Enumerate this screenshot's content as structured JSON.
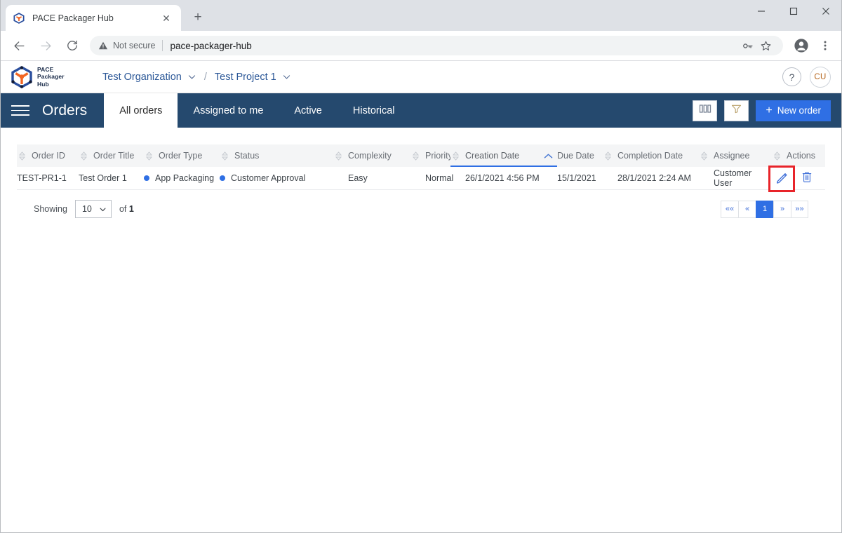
{
  "browser": {
    "tab": {
      "title": "PACE Packager Hub",
      "favicon": "cube-icon",
      "close": "✕"
    },
    "new_tab": "+",
    "window_controls": {
      "minimize": "—",
      "maximize": "□",
      "close": "✕"
    },
    "nav": {
      "back": "←",
      "forward": "→",
      "reload": "↻"
    },
    "omnibox": {
      "security_label": "Not secure",
      "url": "pace-packager-hub",
      "key_icon": "key-icon",
      "star_icon": "star-icon"
    },
    "toolbar_right": {
      "profile_icon": "profile-avatar-icon",
      "menu_icon": "three-dot-menu-icon"
    }
  },
  "app_header": {
    "logo": {
      "line1": "PACE",
      "line2": "Packager",
      "line3": "Hub"
    },
    "breadcrumb": {
      "organization": "Test Organization",
      "separator": "/",
      "project": "Test Project 1"
    },
    "help_label": "?",
    "avatar_initials": "CU"
  },
  "navbar": {
    "menu_icon": "hamburger-menu-icon",
    "title": "Orders",
    "tabs": [
      {
        "label": "All orders",
        "active": true
      },
      {
        "label": "Assigned to me",
        "active": false
      },
      {
        "label": "Active",
        "active": false
      },
      {
        "label": "Historical",
        "active": false
      }
    ],
    "actions": {
      "columns_icon": "columns-icon",
      "filter_icon": "filter-funnel-icon",
      "new_order_label": "New order",
      "new_order_plus": "+"
    }
  },
  "table": {
    "columns": [
      {
        "label": "Order ID",
        "sorted": false
      },
      {
        "label": "Order Title",
        "sorted": false
      },
      {
        "label": "Order Type",
        "sorted": false
      },
      {
        "label": "Status",
        "sorted": false
      },
      {
        "label": "Complexity",
        "sorted": false
      },
      {
        "label": "Priority",
        "sorted": false
      },
      {
        "label": "Creation Date",
        "sorted": true,
        "sort_direction": "asc"
      },
      {
        "label": "Due Date",
        "sorted": false
      },
      {
        "label": "Completion Date",
        "sorted": false
      },
      {
        "label": "Assignee",
        "sorted": false
      },
      {
        "label": "Actions",
        "sorted": false
      }
    ],
    "rows": [
      {
        "order_id": "TEST-PR1-1",
        "order_title": "Test Order 1",
        "order_type": "App Packaging",
        "status": "Customer Approval",
        "complexity": "Easy",
        "priority": "Normal",
        "creation_date": "26/1/2021 4:56 PM",
        "due_date": "15/1/2021",
        "completion_date": "28/1/2021 2:24 AM",
        "assignee": "Customer User",
        "edit_icon": "pencil-edit-icon",
        "delete_icon": "trash-delete-icon"
      }
    ]
  },
  "footer": {
    "showing_label": "Showing",
    "page_size_value": "10",
    "page_size_options": [
      "10"
    ],
    "of_label": "of",
    "total_count": "1",
    "pager": [
      {
        "label": "««",
        "active": false
      },
      {
        "label": "«",
        "active": false
      },
      {
        "label": "1",
        "active": true
      },
      {
        "label": "»",
        "active": false
      },
      {
        "label": "»»",
        "active": false
      }
    ]
  },
  "colors": {
    "navbar": "#25496e",
    "accent_blue": "#2f6fe4",
    "highlight_red": "#e8242a",
    "logo_blue": "#2b4f9e",
    "logo_orange": "#f26522"
  }
}
